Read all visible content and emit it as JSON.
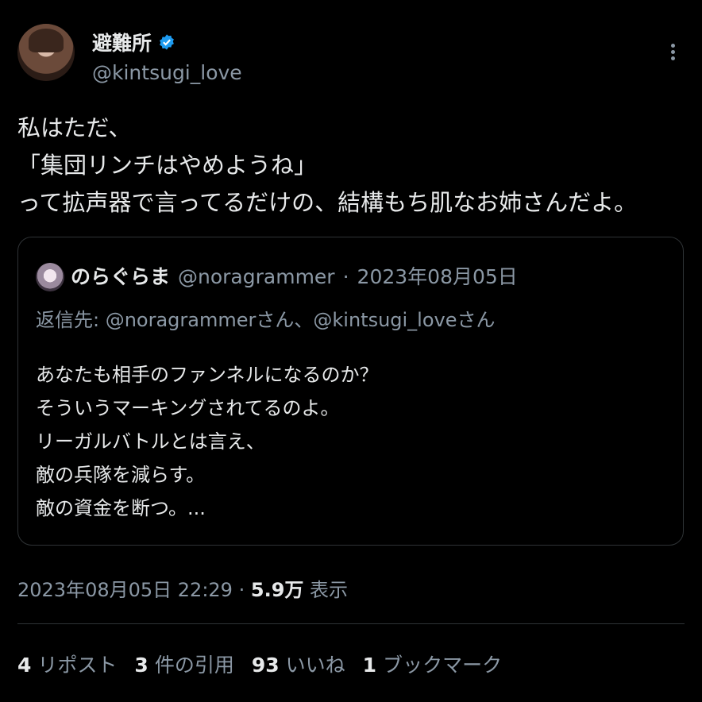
{
  "author": {
    "display_name": "避難所",
    "handle": "@kintsugi_love"
  },
  "tweet": {
    "text": "私はただ、\n「集団リンチはやめようね」\nって拡声器で言ってるだけの、結構もち肌なお姉さんだよ。"
  },
  "quote": {
    "name": "のらぐらま",
    "handle": "@noragrammer",
    "separator": "·",
    "date": "2023年08月05日",
    "reply_to": "返信先: @noragrammerさん、@kintsugi_loveさん",
    "text": "あなたも相手のファンネルになるのか？\nそういうマーキングされてるのよ。\nリーガルバトルとは言え、\n敵の兵隊を減らす。\n敵の資金を断つ。..."
  },
  "meta": {
    "timestamp": "2023年08月05日 22:29",
    "separator": "·",
    "views": "5.9万",
    "views_label": "表示"
  },
  "stats": {
    "reposts_count": "4",
    "reposts_label": "リポスト",
    "quotes_count": "3",
    "quotes_label": "件の引用",
    "likes_count": "93",
    "likes_label": "いいね",
    "bookmarks_count": "1",
    "bookmarks_label": "ブックマーク"
  },
  "colors": {
    "background": "#000000",
    "text": "#e7e9ea",
    "secondary": "#8b98a5",
    "verified": "#1d9bf0",
    "border": "#2f3336"
  }
}
